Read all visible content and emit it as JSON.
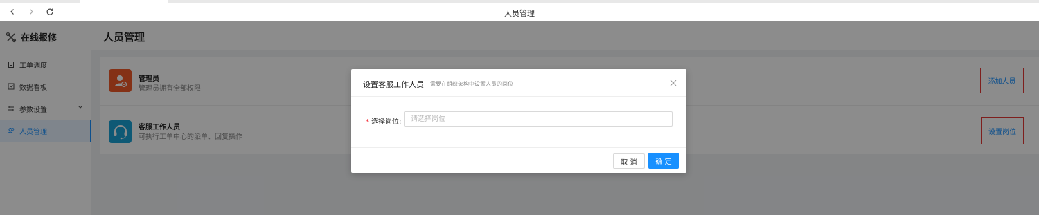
{
  "browser": {
    "back_icon": "chevron-left-icon",
    "forward_icon": "chevron-right-icon",
    "reload_icon": "reload-icon",
    "title": "人员管理"
  },
  "sidebar": {
    "brand": "在线报修",
    "brand_icon": "wrench-screwdriver-icon",
    "items": [
      {
        "label": "工单调度",
        "icon": "clipboard-icon"
      },
      {
        "label": "数据看板",
        "icon": "chart-board-icon"
      },
      {
        "label": "参数设置",
        "icon": "sliders-icon",
        "expandable": true
      },
      {
        "label": "人员管理",
        "icon": "users-icon",
        "active": true
      }
    ]
  },
  "main": {
    "title": "人员管理",
    "roles": [
      {
        "name": "管理员",
        "desc": "管理员拥有全部权限",
        "icon": "admin-user-icon",
        "color": "#f05a28",
        "action": "添加人员"
      },
      {
        "name": "客服工作人员",
        "desc": "可执行工单中心的派单、回复操作",
        "icon": "headset-icon",
        "color": "#1aa3d6",
        "action": "设置岗位"
      }
    ]
  },
  "modal": {
    "title": "设置客服工作人员",
    "subtitle": "需要在组织架构中设置人员的岗位",
    "field_label": "选择岗位:",
    "field_required": "*",
    "field_placeholder": "请选择岗位",
    "field_value": "",
    "cancel": "取 消",
    "ok": "确 定"
  },
  "colors": {
    "primary": "#1890ff",
    "highlight_border": "#e53935"
  }
}
